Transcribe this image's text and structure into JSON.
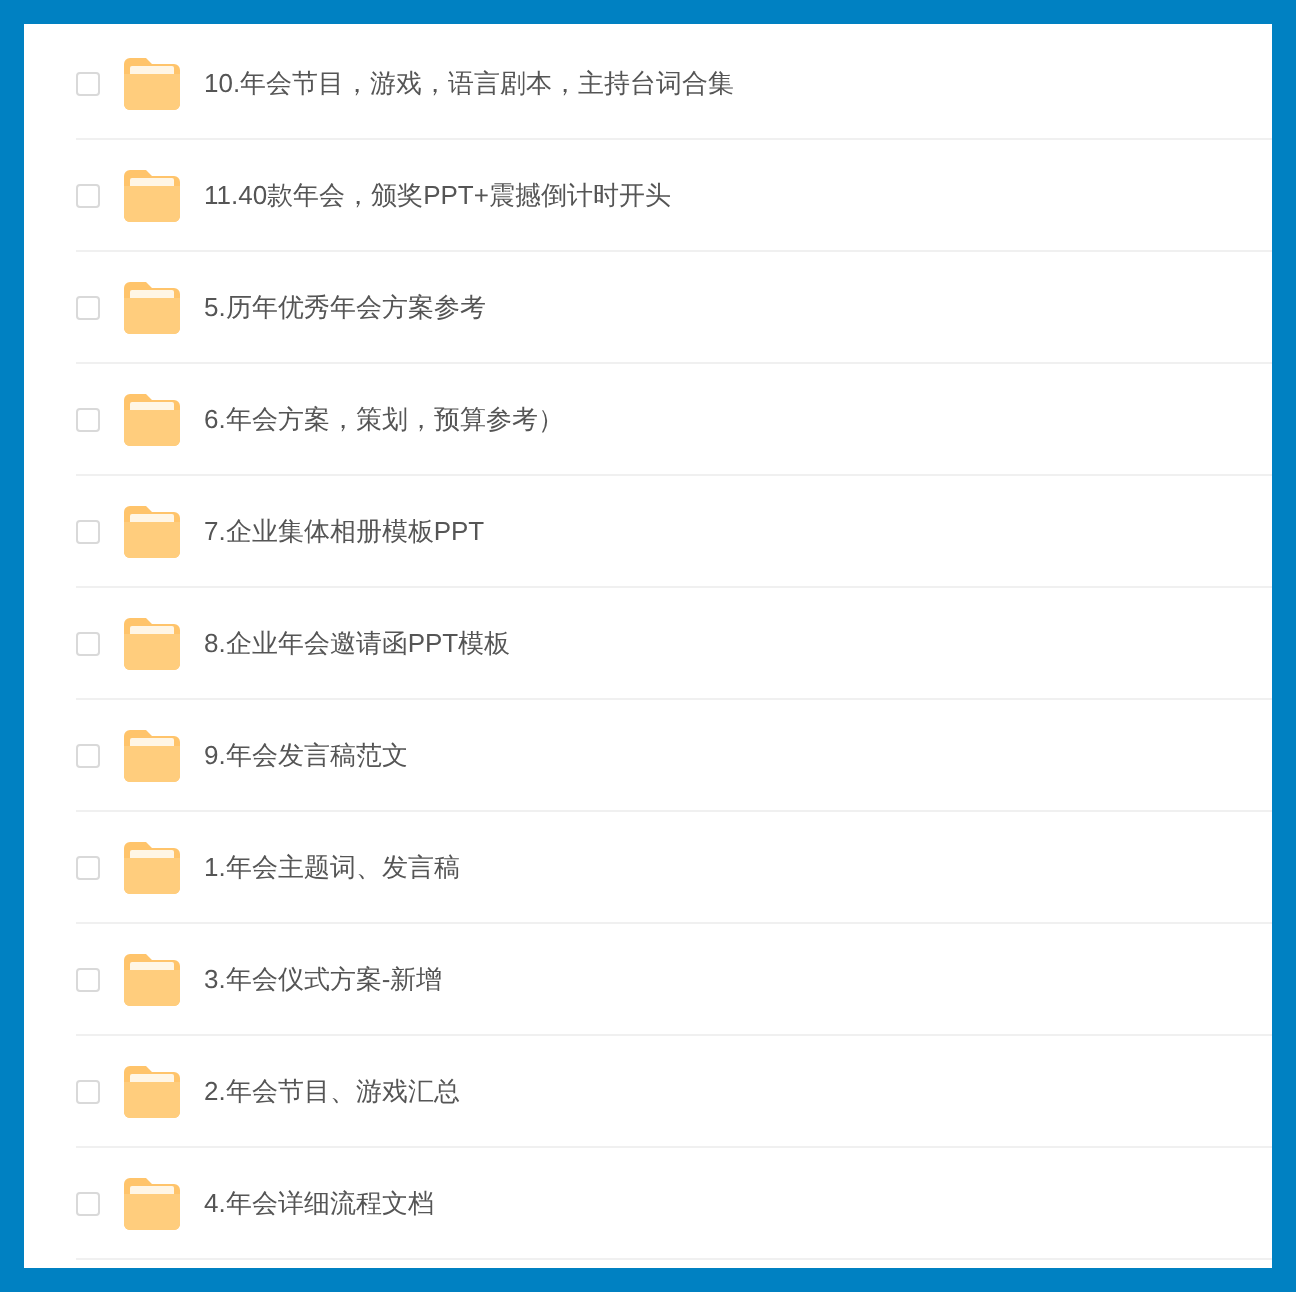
{
  "files": [
    {
      "name": "10.年会节目，游戏，语言剧本，主持台词合集",
      "checked": false
    },
    {
      "name": "11.40款年会，颁奖PPT+震撼倒计时开头",
      "checked": false
    },
    {
      "name": "5.历年优秀年会方案参考",
      "checked": false
    },
    {
      "name": "6.年会方案，策划，预算参考）",
      "checked": false
    },
    {
      "name": "7.企业集体相册模板PPT",
      "checked": false
    },
    {
      "name": "8.企业年会邀请函PPT模板",
      "checked": false
    },
    {
      "name": "9.年会发言稿范文",
      "checked": false
    },
    {
      "name": "1.年会主题词、发言稿",
      "checked": false
    },
    {
      "name": "3.年会仪式方案-新增",
      "checked": false
    },
    {
      "name": "2.年会节目、游戏汇总",
      "checked": false
    },
    {
      "name": "4.年会详细流程文档",
      "checked": false
    }
  ]
}
